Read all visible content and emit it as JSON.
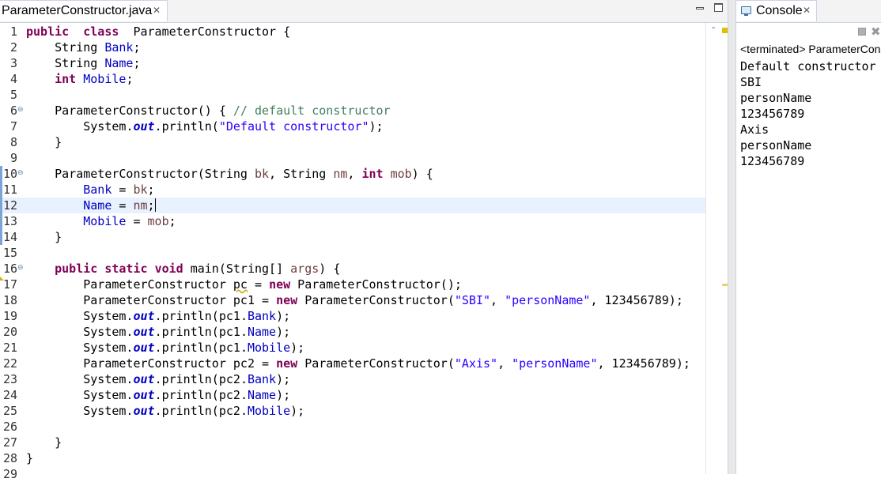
{
  "editor": {
    "tab_label": "ParameterConstructor.java",
    "close_glyph": "✕",
    "current_line": 12,
    "lines": [
      {
        "n": "1"
      },
      {
        "n": "2"
      },
      {
        "n": "3"
      },
      {
        "n": "4"
      },
      {
        "n": "5"
      },
      {
        "n": "6"
      },
      {
        "n": "7"
      },
      {
        "n": "8"
      },
      {
        "n": "9"
      },
      {
        "n": "10"
      },
      {
        "n": "11"
      },
      {
        "n": "12"
      },
      {
        "n": "13"
      },
      {
        "n": "14"
      },
      {
        "n": "15"
      },
      {
        "n": "16"
      },
      {
        "n": "17"
      },
      {
        "n": "18"
      },
      {
        "n": "19"
      },
      {
        "n": "20"
      },
      {
        "n": "21"
      },
      {
        "n": "22"
      },
      {
        "n": "23"
      },
      {
        "n": "24"
      },
      {
        "n": "25"
      },
      {
        "n": "26"
      },
      {
        "n": "27"
      },
      {
        "n": "28"
      },
      {
        "n": "29"
      }
    ],
    "folded_lines": [
      6,
      10,
      16
    ],
    "warning_line": 17,
    "code": [
      [
        [
          "kw",
          "public"
        ],
        [
          "",
          "  "
        ],
        [
          "kw",
          "class"
        ],
        [
          "",
          "  ParameterConstructor {"
        ]
      ],
      [
        [
          "",
          "    String "
        ],
        [
          "fld",
          "Bank"
        ],
        [
          "",
          ";"
        ]
      ],
      [
        [
          "",
          "    String "
        ],
        [
          "fld",
          "Name"
        ],
        [
          "",
          ";"
        ]
      ],
      [
        [
          "",
          "    "
        ],
        [
          "kw",
          "int"
        ],
        [
          "",
          " "
        ],
        [
          "fld",
          "Mobile"
        ],
        [
          "",
          ";"
        ]
      ],
      [],
      [
        [
          "",
          "    ParameterConstructor() { "
        ],
        [
          "cmt",
          "// default constructor"
        ]
      ],
      [
        [
          "",
          "        System."
        ],
        [
          "stat",
          "out"
        ],
        [
          "",
          ".println("
        ],
        [
          "str",
          "\"Default constructor\""
        ],
        [
          "",
          ");"
        ]
      ],
      [
        [
          "",
          "    }"
        ]
      ],
      [],
      [
        [
          "",
          "    ParameterConstructor(String "
        ],
        [
          "par",
          "bk"
        ],
        [
          "",
          ", String "
        ],
        [
          "par",
          "nm"
        ],
        [
          "",
          ", "
        ],
        [
          "kw",
          "int"
        ],
        [
          "",
          " "
        ],
        [
          "par",
          "mob"
        ],
        [
          "",
          ") {"
        ]
      ],
      [
        [
          "",
          "        "
        ],
        [
          "fld",
          "Bank"
        ],
        [
          "",
          " = "
        ],
        [
          "par",
          "bk"
        ],
        [
          "",
          ";"
        ]
      ],
      [
        [
          "",
          "        "
        ],
        [
          "fld",
          "Name"
        ],
        [
          "",
          " = "
        ],
        [
          "par",
          "nm"
        ],
        [
          "",
          ";"
        ],
        [
          "caret",
          ""
        ]
      ],
      [
        [
          "",
          "        "
        ],
        [
          "fld",
          "Mobile"
        ],
        [
          "",
          " = "
        ],
        [
          "par",
          "mob"
        ],
        [
          "",
          ";"
        ]
      ],
      [
        [
          "",
          "    }"
        ]
      ],
      [],
      [
        [
          "",
          "    "
        ],
        [
          "kw",
          "public"
        ],
        [
          "",
          " "
        ],
        [
          "kw",
          "static"
        ],
        [
          "",
          " "
        ],
        [
          "kw",
          "void"
        ],
        [
          "",
          " main(String[] "
        ],
        [
          "par",
          "args"
        ],
        [
          "",
          ") {"
        ]
      ],
      [
        [
          "",
          "        ParameterConstructor "
        ],
        [
          "warn",
          "pc"
        ],
        [
          "",
          " = "
        ],
        [
          "kw",
          "new"
        ],
        [
          "",
          " ParameterConstructor();"
        ]
      ],
      [
        [
          "",
          "        ParameterConstructor "
        ],
        [
          "",
          "pc1"
        ],
        [
          "",
          " = "
        ],
        [
          "kw",
          "new"
        ],
        [
          "",
          " ParameterConstructor("
        ],
        [
          "str",
          "\"SBI\""
        ],
        [
          "",
          ", "
        ],
        [
          "str",
          "\"personName\""
        ],
        [
          "",
          ", 123456789);"
        ]
      ],
      [
        [
          "",
          "        System."
        ],
        [
          "stat",
          "out"
        ],
        [
          "",
          ".println("
        ],
        [
          "",
          "pc1"
        ],
        [
          "",
          "."
        ],
        [
          "fld",
          "Bank"
        ],
        [
          "",
          ");"
        ]
      ],
      [
        [
          "",
          "        System."
        ],
        [
          "stat",
          "out"
        ],
        [
          "",
          ".println("
        ],
        [
          "",
          "pc1"
        ],
        [
          "",
          "."
        ],
        [
          "fld",
          "Name"
        ],
        [
          "",
          ");"
        ]
      ],
      [
        [
          "",
          "        System."
        ],
        [
          "stat",
          "out"
        ],
        [
          "",
          ".println("
        ],
        [
          "",
          "pc1"
        ],
        [
          "",
          "."
        ],
        [
          "fld",
          "Mobile"
        ],
        [
          "",
          ");"
        ]
      ],
      [
        [
          "",
          "        ParameterConstructor "
        ],
        [
          "",
          "pc2"
        ],
        [
          "",
          " = "
        ],
        [
          "kw",
          "new"
        ],
        [
          "",
          " ParameterConstructor("
        ],
        [
          "str",
          "\"Axis\""
        ],
        [
          "",
          ", "
        ],
        [
          "str",
          "\"personName\""
        ],
        [
          "",
          ", 123456789);"
        ]
      ],
      [
        [
          "",
          "        System."
        ],
        [
          "stat",
          "out"
        ],
        [
          "",
          ".println("
        ],
        [
          "",
          "pc2"
        ],
        [
          "",
          "."
        ],
        [
          "fld",
          "Bank"
        ],
        [
          "",
          ");"
        ]
      ],
      [
        [
          "",
          "        System."
        ],
        [
          "stat",
          "out"
        ],
        [
          "",
          ".println("
        ],
        [
          "",
          "pc2"
        ],
        [
          "",
          "."
        ],
        [
          "fld",
          "Name"
        ],
        [
          "",
          ");"
        ]
      ],
      [
        [
          "",
          "        System."
        ],
        [
          "stat",
          "out"
        ],
        [
          "",
          ".println("
        ],
        [
          "",
          "pc2"
        ],
        [
          "",
          "."
        ],
        [
          "fld",
          "Mobile"
        ],
        [
          "",
          ");"
        ]
      ],
      [],
      [
        [
          "",
          "    }"
        ]
      ],
      [
        [
          "",
          "}"
        ]
      ],
      []
    ]
  },
  "console": {
    "tab_label": "Console",
    "close_glyph": "✕",
    "header": "<terminated> ParameterConstructor",
    "output": [
      "Default constructor",
      "SBI",
      "personName",
      "123456789",
      "Axis",
      "personName",
      "123456789"
    ]
  },
  "colors": {
    "keyword": "#7f0055",
    "field": "#0000c0",
    "string": "#2a00ff",
    "comment": "#3f7f5f",
    "parameter": "#6a3e3e",
    "current_line_highlight": "#e8f2fe"
  }
}
